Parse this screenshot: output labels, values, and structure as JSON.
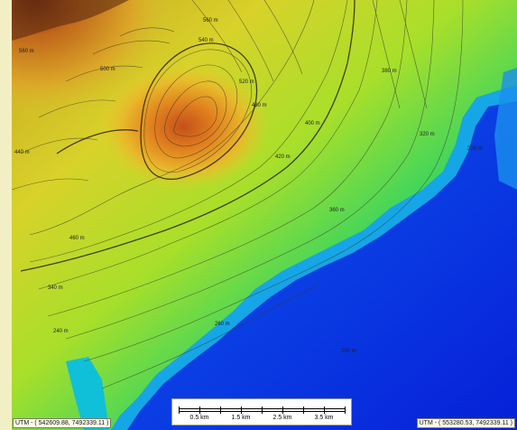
{
  "map": {
    "contour_labels": [
      {
        "text": "560 m"
      },
      {
        "text": "560 m"
      },
      {
        "text": "540 m"
      },
      {
        "text": "520 m"
      },
      {
        "text": "500 m"
      },
      {
        "text": "480 m"
      },
      {
        "text": "460 m"
      },
      {
        "text": "440 m"
      },
      {
        "text": "420 m"
      },
      {
        "text": "400 m"
      },
      {
        "text": "380 m"
      },
      {
        "text": "360 m"
      },
      {
        "text": "340 m"
      },
      {
        "text": "320 m"
      },
      {
        "text": "300 m"
      },
      {
        "text": "280 m"
      },
      {
        "text": "260 m"
      },
      {
        "text": "240 m"
      }
    ],
    "coordinates": {
      "left": "UTM - ( 542609.88, 7492339.11 )",
      "right": "UTM - ( 553280.53, 7492339.11 )"
    },
    "scale_bar": {
      "labels": [
        "0.5 km",
        "1.5 km",
        "2.5 km",
        "3.5 km"
      ]
    },
    "colors": {
      "peak": "#c85a1e",
      "high": "#e8b818",
      "mid": "#88d830",
      "low": "#10d0b0",
      "deep": "#0a2ee0"
    }
  }
}
